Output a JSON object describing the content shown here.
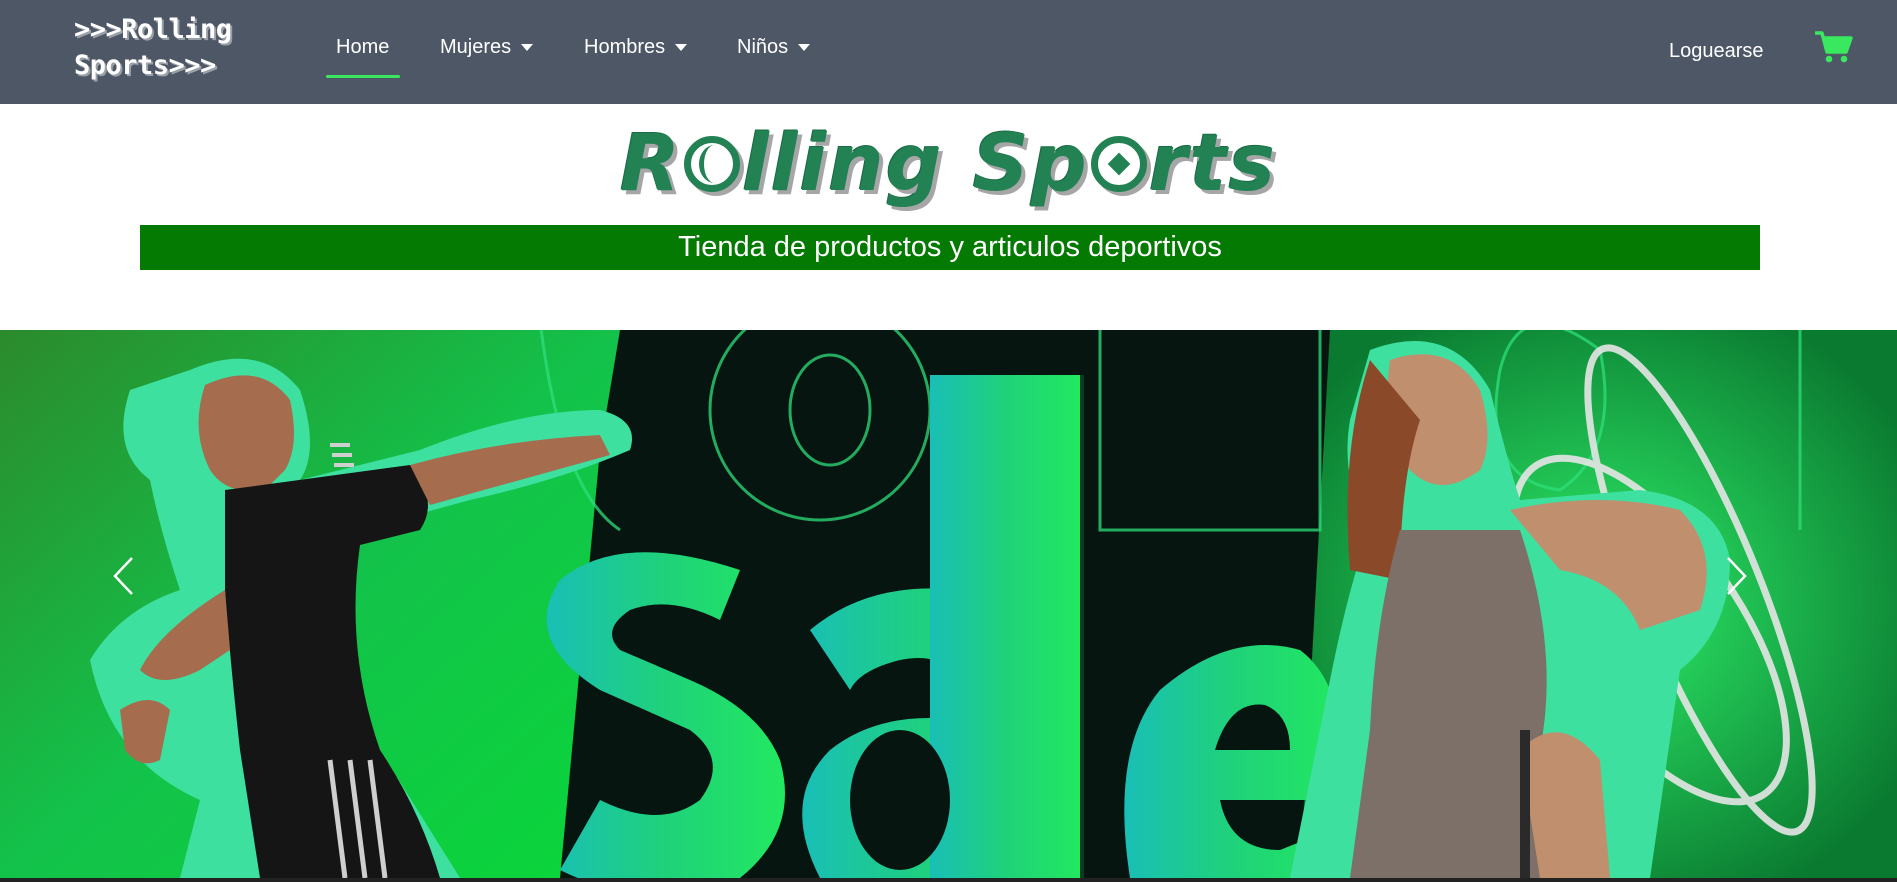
{
  "navbar": {
    "brand_line1": ">>>Rolling",
    "brand_line2": "Sports>>>",
    "links": [
      {
        "label": "Home",
        "active": true
      },
      {
        "label": "Mujeres",
        "dropdown": true
      },
      {
        "label": "Hombres",
        "dropdown": true
      },
      {
        "label": "Niños",
        "dropdown": true
      }
    ],
    "login_label": "Loguearse",
    "cart_icon": "shopping-cart-icon"
  },
  "header": {
    "logo_part1": "R",
    "logo_part2": "lling Sp",
    "logo_part3": "rts",
    "tagline": "Tienda de productos y articulos deportivos"
  },
  "carousel": {
    "slide_word": "sale",
    "prev_icon": "chevron-left-icon",
    "next_icon": "chevron-right-icon"
  },
  "colors": {
    "navbar_bg": "#4d5766",
    "accent_green": "#39e85f",
    "logo_green": "#238254",
    "tagline_bg": "#047a02"
  }
}
